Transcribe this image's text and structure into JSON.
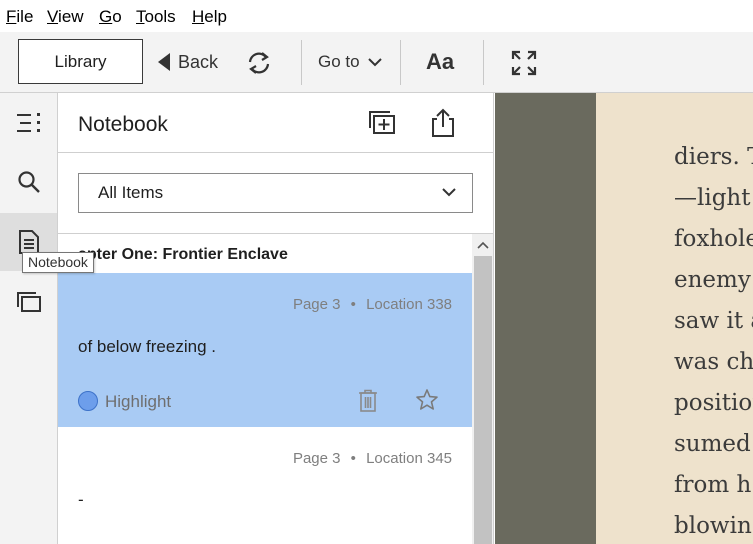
{
  "menu": {
    "file": {
      "u": "F",
      "rest": "ile"
    },
    "view": {
      "u": "V",
      "rest": "iew"
    },
    "go": {
      "u": "G",
      "rest": "o"
    },
    "tools": {
      "u": "T",
      "rest": "ools"
    },
    "help": {
      "u": "H",
      "rest": "elp"
    }
  },
  "toolbar": {
    "library_label": "Library",
    "back_label": "Back",
    "goto_label": "Go to",
    "font_label": "Aa"
  },
  "tooltip": "Notebook",
  "notebook": {
    "title": "Notebook",
    "filter_value": "All Items",
    "chapter": "Chapter One: Frontier Enclave",
    "chapter_visible": "apter One: Frontier Enclave",
    "notes": [
      {
        "page": "Page 3",
        "location": "Location 338",
        "text": "of below freezing .",
        "type": "Highlight"
      },
      {
        "page": "Page 3",
        "location": "Location 345",
        "text": "-"
      }
    ],
    "separator": "•"
  },
  "book": {
    "lines": [
      "diers. T",
      "—light",
      "foxhole",
      "enemy",
      "saw it a",
      "was ch",
      "position",
      "sumed",
      "from h",
      "blowin"
    ]
  },
  "colors": {
    "highlight_bg": "#a9cbf4",
    "highlight_dot": "#6d9eeb",
    "page_bg": "#eee2cc",
    "page_margin": "#6a6a5e"
  }
}
